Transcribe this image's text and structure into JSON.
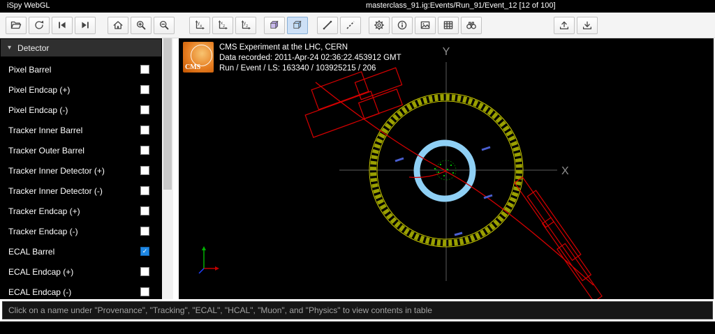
{
  "titlebar": {
    "app_name": "iSpy WebGL",
    "event_path": "masterclass_91.ig:Events/Run_91/Event_12 [12 of 100]"
  },
  "toolbar": {
    "icons": [
      "open-file",
      "reload",
      "previous-event",
      "next-event",
      "home-view",
      "zoom-in",
      "zoom-out",
      "view-xy",
      "view-xz",
      "view-yz",
      "perspective-view",
      "orthographic-view",
      "line-tool",
      "dashed-line-tool",
      "settings",
      "info",
      "screenshot",
      "table-view",
      "search",
      "upload",
      "download"
    ],
    "active_button": "orthographic-view"
  },
  "sidebar": {
    "header": "Detector",
    "chevron": "▾",
    "items": [
      {
        "label": "Pixel Barrel",
        "checked": false
      },
      {
        "label": "Pixel Endcap (+)",
        "checked": false
      },
      {
        "label": "Pixel Endcap (-)",
        "checked": false
      },
      {
        "label": "Tracker Inner Barrel",
        "checked": false
      },
      {
        "label": "Tracker Outer Barrel",
        "checked": false
      },
      {
        "label": "Tracker Inner Detector (+)",
        "checked": false
      },
      {
        "label": "Tracker Inner Detector (-)",
        "checked": false
      },
      {
        "label": "Tracker Endcap (+)",
        "checked": false
      },
      {
        "label": "Tracker Endcap (-)",
        "checked": false
      },
      {
        "label": "ECAL Barrel",
        "checked": true
      },
      {
        "label": "ECAL Endcap (+)",
        "checked": false
      },
      {
        "label": "ECAL Endcap (-)",
        "checked": false
      }
    ]
  },
  "viewer": {
    "logo_text": "CMS",
    "info_lines": [
      "CMS Experiment at the LHC, CERN",
      "Data recorded: 2011-Apr-24 02:36:22.453912 GMT",
      "Run / Event / LS: 163340 / 103925215 / 206"
    ],
    "axis_labels": {
      "x": "X",
      "y": "Y"
    },
    "colors": {
      "ecal_ring": "#b5b500",
      "muon_ring": "#8fd0f5",
      "tracks": "#d40000",
      "hits_blue": "#4a5fd0",
      "hits_green": "#00c000"
    }
  },
  "statusbar": {
    "message": "Click on a name under \"Provenance\", \"Tracking\", \"ECAL\", \"HCAL\", \"Muon\", and \"Physics\" to view contents in table"
  }
}
